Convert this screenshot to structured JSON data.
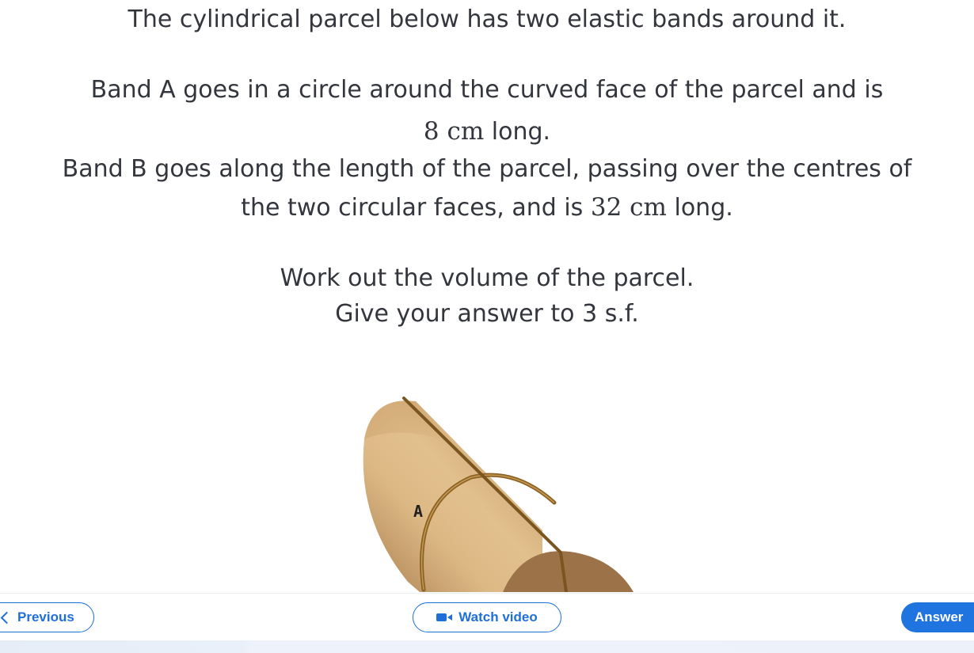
{
  "question": {
    "line1": "The cylindrical parcel below has two elastic bands around it.",
    "line2": "Band A goes in a circle around the curved face of the parcel and is",
    "line3_value": "8",
    "line3_unit": "cm",
    "line3_rest": "long.",
    "line4": "Band B goes along the length of the parcel, passing over the centres of",
    "line5_text": "the two circular faces, and is",
    "line5_value": "32",
    "line5_unit": "cm",
    "line5_rest": "long.",
    "line6": "Work out the volume of the parcel.",
    "line7": "Give your answer to 3 s.f."
  },
  "figure": {
    "band_a_label": "A",
    "colors": {
      "parcel_light": "#e0bb86",
      "parcel_dark": "#b08557",
      "end_face": "#9c7248",
      "band": "#8c6224"
    }
  },
  "nav": {
    "previous_label": "Previous",
    "video_label": "Watch video",
    "answer_label": "Answer"
  },
  "colors": {
    "accent": "#1f6fd8",
    "text": "#33363d"
  }
}
